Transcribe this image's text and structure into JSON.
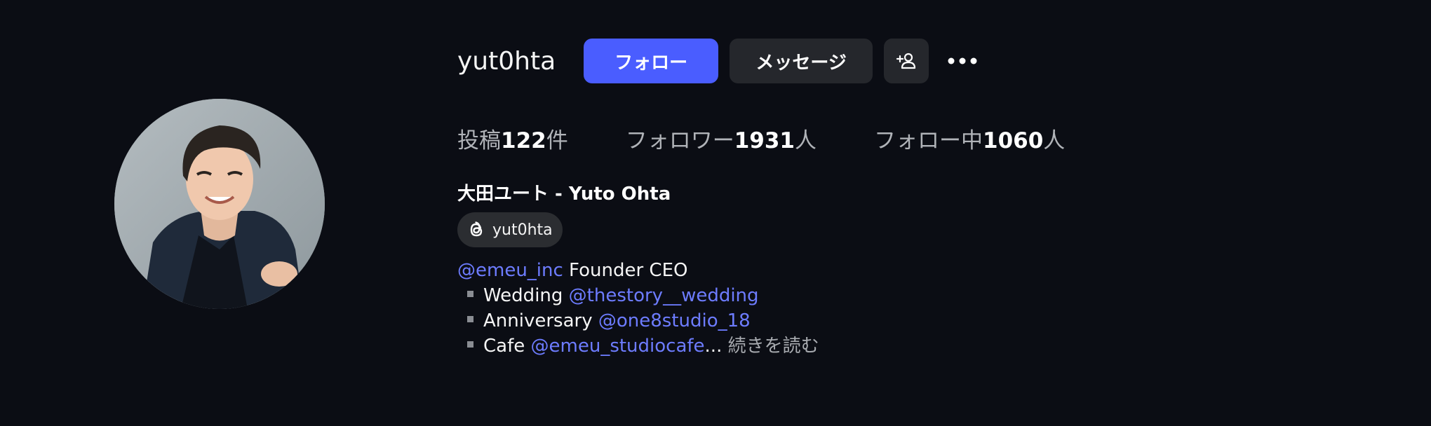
{
  "profile": {
    "username": "yut0hta",
    "full_name": "大田ユート - Yuto Ohta",
    "threads_handle": "yut0hta"
  },
  "actions": {
    "follow_label": "フォロー",
    "message_label": "メッセージ",
    "add_user_icon": "add-user-icon",
    "more_icon": "more-icon"
  },
  "stats": {
    "posts_prefix": "投稿",
    "posts_count": "122",
    "posts_suffix": "件",
    "followers_prefix": "フォロワー",
    "followers_count": "1931",
    "followers_suffix": "人",
    "following_prefix": "フォロー中",
    "following_count": "1060",
    "following_suffix": "人"
  },
  "bio": {
    "line1_mention": "@emeu_inc",
    "line1_text": " Founder CEO",
    "items": [
      {
        "label": "Wedding ",
        "mention": "@thestory__wedding",
        "tail": ""
      },
      {
        "label": "Anniversary ",
        "mention": "@one8studio_18",
        "tail": ""
      },
      {
        "label": "Cafe ",
        "mention": "@emeu_studiocafe",
        "tail": "..."
      }
    ],
    "read_more": " 続きを読む"
  },
  "colors": {
    "background": "#0b0d14",
    "accent": "#4a5dff",
    "mention": "#6d7cff",
    "button_dark": "#25272c"
  }
}
